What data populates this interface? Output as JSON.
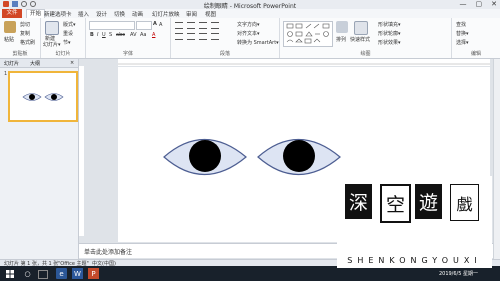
{
  "window": {
    "title": "绘制眼睛 - Microsoft PowerPoint",
    "controls": [
      "—",
      "▢",
      "✕"
    ]
  },
  "ribbon": {
    "tabs": [
      "文件",
      "开始",
      "新建选项卡",
      "插入",
      "设计",
      "切换",
      "动画",
      "幻灯片放映",
      "审阅",
      "视图"
    ],
    "groups": {
      "clipboard": {
        "label": "剪贴板",
        "paste": "粘贴",
        "cut": "剪切",
        "copy": "复制",
        "format_painter": "格式刷"
      },
      "slides": {
        "label": "幻灯片",
        "new_slide": "新建",
        "new_slide_sub": "幻灯片▾",
        "layout": "版式▾",
        "reset": "重设",
        "section": "节▾"
      },
      "font": {
        "label": "字体"
      },
      "paragraph": {
        "label": "段落",
        "text_direction": "文字方向▾",
        "align_text": "对齐文本▾",
        "smartart": "转换为 SmartArt▾"
      },
      "drawing": {
        "label": "绘图",
        "arrange": "排列",
        "quick_styles": "快速样式",
        "shape_fill": "形状填充▾",
        "shape_outline": "形状轮廓▾",
        "shape_effects": "形状效果▾"
      },
      "editing": {
        "label": "编辑",
        "find": "查找",
        "replace": "替换▾",
        "select": "选择▾"
      }
    }
  },
  "side_panel": {
    "tabs": [
      "幻灯片",
      "大纲"
    ],
    "close": "×",
    "slide_number": "1"
  },
  "notes": {
    "placeholder": "单击此处添加备注"
  },
  "statusbar": {
    "slide_info": "幻灯片 第 1 张，共 1 张",
    "theme": "\"Office 主题\"",
    "language": "中文(中国)"
  },
  "taskbar": {
    "clock": "2019/6/5 星期一"
  },
  "watermark": {
    "characters": [
      "深",
      "空",
      "遊",
      "戲"
    ],
    "brand": "SHENKONGYOUXI"
  },
  "colors": {
    "eye_fill": "#dde4f3",
    "eye_outline": "#4d5e92",
    "pupil": "#000000",
    "file_tab": "#d24726"
  }
}
